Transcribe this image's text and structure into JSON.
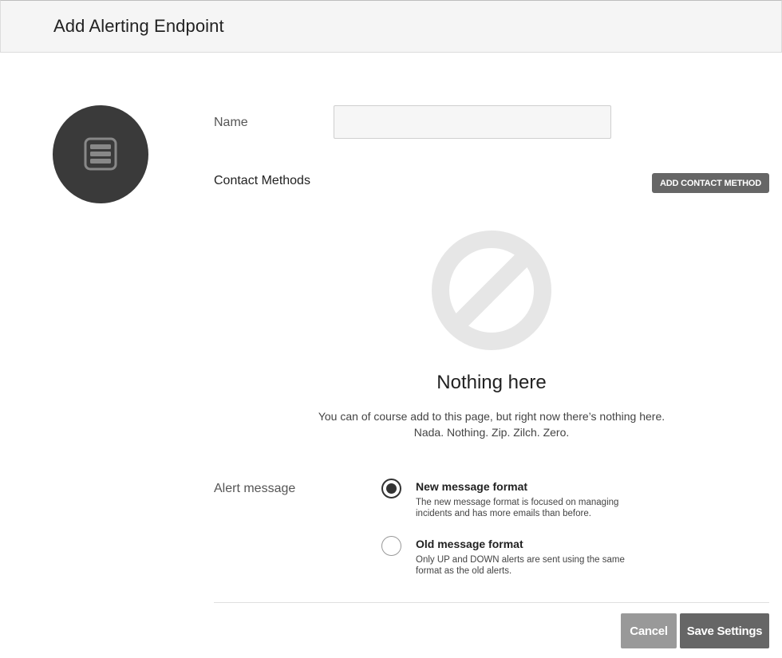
{
  "header": {
    "title": "Add Alerting Endpoint"
  },
  "avatar": {
    "icon": "server-stack-icon"
  },
  "form": {
    "name_label": "Name",
    "name_value": "",
    "name_placeholder": "",
    "contact_methods_title": "Contact Methods",
    "add_contact_method_label": "ADD CONTACT METHOD"
  },
  "empty_state": {
    "icon": "no-entry-icon",
    "title": "Nothing here",
    "line1": "You can of course add to this page, but right now there’s nothing here.",
    "line2": "Nada. Nothing. Zip. Zilch. Zero."
  },
  "alert_message": {
    "label": "Alert message",
    "options": [
      {
        "title": "New message format",
        "description": "The new message format is focused on managing incidents and has more emails than before.",
        "selected": true
      },
      {
        "title": "Old message format",
        "description": "Only UP and DOWN alerts are sent using the same format as the old alerts.",
        "selected": false
      }
    ]
  },
  "footer": {
    "cancel_label": "Cancel",
    "save_label": "Save Settings"
  },
  "colors": {
    "primary_button": "#666666",
    "secondary_button": "#999999",
    "avatar_bg": "#3a3a3a",
    "empty_icon": "#e6e6e6"
  }
}
